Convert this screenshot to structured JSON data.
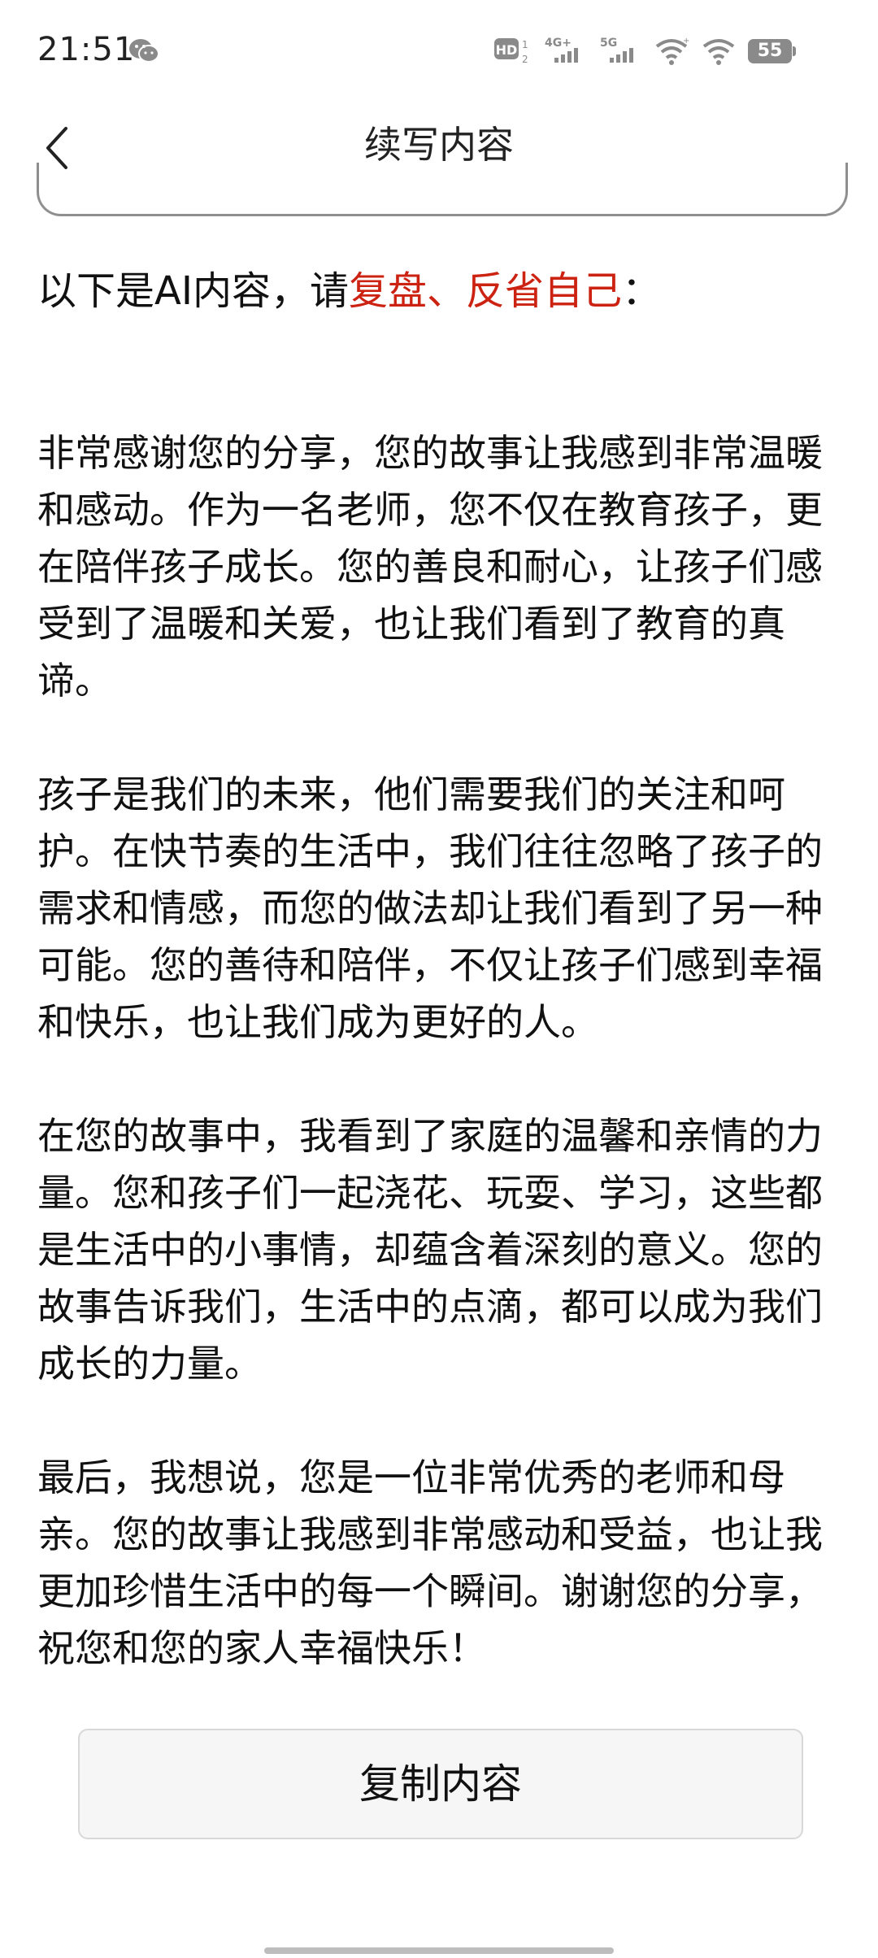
{
  "status_bar": {
    "time": "21:51",
    "hd_label": "HD",
    "network_1": "4G+",
    "network_2": "5G",
    "battery": "55",
    "icons": [
      "wechat-icon",
      "hd-icon",
      "signal-4g-icon",
      "signal-5g-icon",
      "wifi-icon",
      "wifi-icon",
      "battery-icon"
    ]
  },
  "header": {
    "title": "续写内容",
    "back_icon": "chevron-left-icon"
  },
  "prompt": {
    "prefix": "以下是AI内容，请",
    "highlight": "复盘、反省自己",
    "suffix": "：",
    "highlight_color": "#cc2211"
  },
  "ai_content": {
    "paragraphs": [
      "非常感谢您的分享，您的故事让我感到非常温暖和感动。作为一名老师，您不仅在教育孩子，更在陪伴孩子成长。您的善良和耐心，让孩子们感受到了温暖和关爱，也让我们看到了教育的真谛。",
      "孩子是我们的未来，他们需要我们的关注和呵护。在快节奏的生活中，我们往往忽略了孩子的需求和情感，而您的做法却让我们看到了另一种可能。您的善待和陪伴，不仅让孩子们感到幸福和快乐，也让我们成为更好的人。",
      "在您的故事中，我看到了家庭的温馨和亲情的力量。您和孩子们一起浇花、玩耍、学习，这些都是生活中的小事情，却蕴含着深刻的意义。您的故事告诉我们，生活中的点滴，都可以成为我们成长的力量。",
      "最后，我想说，您是一位非常优秀的老师和母亲。您的故事让我感到非常感动和受益，也让我更加珍惜生活中的每一个瞬间。谢谢您的分享，祝您和您的家人幸福快乐！"
    ]
  },
  "actions": {
    "copy_label": "复制内容"
  }
}
